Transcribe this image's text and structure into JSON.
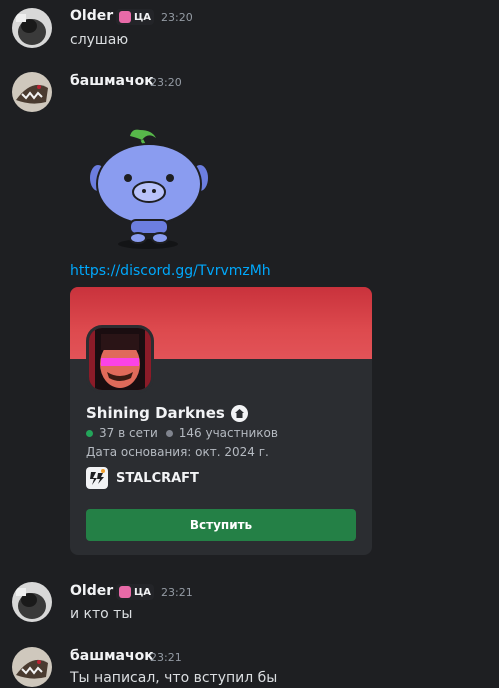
{
  "messages": [
    {
      "username": "Older",
      "tag": "ЦА",
      "time": "23:20",
      "text": "слушаю"
    },
    {
      "username": "башмачок",
      "time": "23:20",
      "link": "https://discord.gg/TvrvmzMh"
    },
    {
      "username": "Older",
      "tag": "ЦА",
      "time": "23:21",
      "text": "и кто ты"
    },
    {
      "username": "башмачок",
      "time": "23:21",
      "text": "Ты написал, что вступил бы"
    }
  ],
  "invite": {
    "server_name": "Shining Darknes",
    "online": "37 в сети",
    "members": "146 участников",
    "founded": "Дата основания: окт. 2024 г.",
    "game": "STALCRAFT",
    "join_label": "Вступить"
  },
  "colors": {
    "background": "#1e1f22",
    "card": "#2b2d31",
    "banner": "#d5403f",
    "online_dot": "#23a55a",
    "members_dot": "#80848e",
    "join_button": "#248046",
    "link": "#00a8fc"
  }
}
